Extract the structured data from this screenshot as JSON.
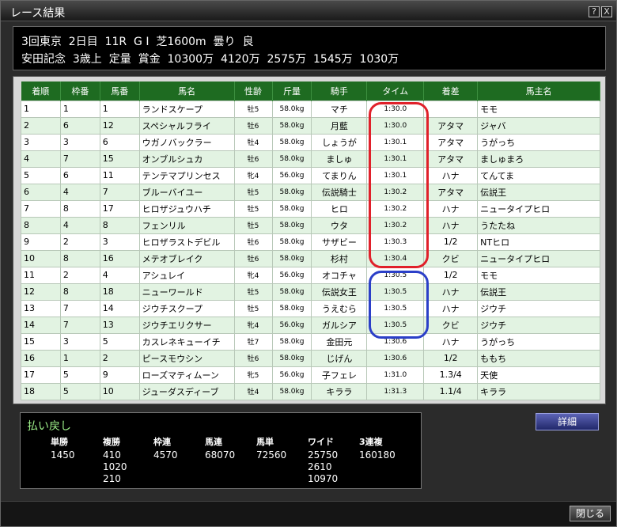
{
  "window": {
    "title": "レース結果",
    "help_label": "?",
    "close_label": "X"
  },
  "race": {
    "line1": "3回東京  2日目  11R  G I  芝1600m  曇り  良",
    "line2": "安田記念  3歳上  定量  賞金  10300万  4120万  2575万  1545万  1030万"
  },
  "table": {
    "headers": [
      "着順",
      "枠番",
      "馬番",
      "馬名",
      "性齢",
      "斤量",
      "騎手",
      "タイム",
      "着差",
      "馬主名"
    ],
    "rows": [
      [
        "1",
        "1",
        "1",
        "ランドスケープ",
        "牡5",
        "58.0kg",
        "マチ",
        "1:30.0",
        "",
        "モモ"
      ],
      [
        "2",
        "6",
        "12",
        "スペシャルフライ",
        "牡6",
        "58.0kg",
        "月藍",
        "1:30.0",
        "アタマ",
        "ジャバ"
      ],
      [
        "3",
        "3",
        "6",
        "ウガノバックラー",
        "牡4",
        "58.0kg",
        "しょうが",
        "1:30.1",
        "アタマ",
        "うがっち"
      ],
      [
        "4",
        "7",
        "15",
        "オンブルシュカ",
        "牡6",
        "58.0kg",
        "ましゅ",
        "1:30.1",
        "アタマ",
        "ましゅまろ"
      ],
      [
        "5",
        "6",
        "11",
        "テンテマプリンセス",
        "牝4",
        "56.0kg",
        "てまりん",
        "1:30.1",
        "ハナ",
        "てんてま"
      ],
      [
        "6",
        "4",
        "7",
        "ブルーバイユー",
        "牡5",
        "58.0kg",
        "伝説騎士",
        "1:30.2",
        "アタマ",
        "伝説王"
      ],
      [
        "7",
        "8",
        "17",
        "ヒロザジュウハチ",
        "牡5",
        "58.0kg",
        "ヒロ",
        "1:30.2",
        "ハナ",
        "ニュータイプヒロ"
      ],
      [
        "8",
        "4",
        "8",
        "フェンリル",
        "牡5",
        "58.0kg",
        "ウタ",
        "1:30.2",
        "ハナ",
        "うたたね"
      ],
      [
        "9",
        "2",
        "3",
        "ヒロザラストデビル",
        "牡6",
        "58.0kg",
        "サザビー",
        "1:30.3",
        "1/2",
        "NTヒロ"
      ],
      [
        "10",
        "8",
        "16",
        "メテオブレイク",
        "牡6",
        "58.0kg",
        "杉村",
        "1:30.4",
        "クビ",
        "ニュータイプヒロ"
      ],
      [
        "11",
        "2",
        "4",
        "アシュレイ",
        "牝4",
        "56.0kg",
        "オコチャ",
        "1:30.5",
        "1/2",
        "モモ"
      ],
      [
        "12",
        "8",
        "18",
        "ニューワールド",
        "牡5",
        "58.0kg",
        "伝説女王",
        "1:30.5",
        "ハナ",
        "伝説王"
      ],
      [
        "13",
        "7",
        "14",
        "ジウチスクープ",
        "牡5",
        "58.0kg",
        "うえむら",
        "1:30.5",
        "ハナ",
        "ジウチ"
      ],
      [
        "14",
        "7",
        "13",
        "ジウチエリクサー",
        "牝4",
        "56.0kg",
        "ガルシア",
        "1:30.5",
        "クビ",
        "ジウチ"
      ],
      [
        "15",
        "3",
        "5",
        "カスレネキューイチ",
        "牡7",
        "58.0kg",
        "金田元",
        "1:30.6",
        "ハナ",
        "うがっち"
      ],
      [
        "16",
        "1",
        "2",
        "ピースモウシン",
        "牡6",
        "58.0kg",
        "じげん",
        "1:30.6",
        "1/2",
        "ももち"
      ],
      [
        "17",
        "5",
        "9",
        "ローズマティムーン",
        "牝5",
        "56.0kg",
        "子フェレ",
        "1:31.0",
        "1.3/4",
        "天使"
      ],
      [
        "18",
        "5",
        "10",
        "ジューダスディーブ",
        "牡4",
        "58.0kg",
        "キララ",
        "1:31.3",
        "1.1/4",
        "キララ"
      ]
    ]
  },
  "payout": {
    "title": "払い戻し",
    "columns": [
      {
        "label": "単勝",
        "values": [
          "1450"
        ]
      },
      {
        "label": "複勝",
        "values": [
          "410",
          "1020",
          "210"
        ]
      },
      {
        "label": "枠連",
        "values": [
          "4570"
        ]
      },
      {
        "label": "馬連",
        "values": [
          "68070"
        ]
      },
      {
        "label": "馬単",
        "values": [
          "72560"
        ]
      },
      {
        "label": "ワイド",
        "values": [
          "25750",
          "2610",
          "10970"
        ]
      },
      {
        "label": "3連複",
        "values": [
          "160180"
        ]
      }
    ]
  },
  "buttons": {
    "detail": "詳細",
    "close": "閉じる"
  },
  "colors": {
    "header_green": "#1e6b21",
    "row_alt": "#e2f3e2",
    "red_marker": "#e0202a",
    "blue_marker": "#2b3fc8",
    "payout_title": "#9ef08a"
  }
}
